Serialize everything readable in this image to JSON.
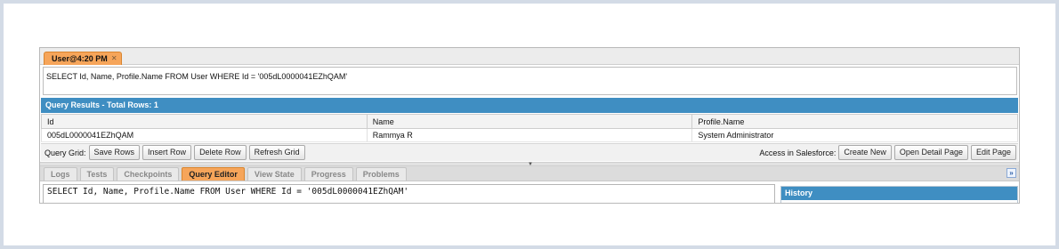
{
  "tab": {
    "label": "User@4:20 PM",
    "close_glyph": "✕"
  },
  "query": {
    "text": "SELECT Id, Name, Profile.Name FROM User WHERE Id = '005dL0000041EZhQAM'"
  },
  "results": {
    "title": "Query Results - Total Rows: 1",
    "columns": [
      "Id",
      "Name",
      "Profile.Name"
    ],
    "rows": [
      [
        "005dL0000041EZhQAM",
        "Rammya R",
        "System Administrator"
      ]
    ]
  },
  "grid_toolbar": {
    "label": "Query Grid:",
    "buttons": [
      "Save Rows",
      "Insert Row",
      "Delete Row",
      "Refresh Grid"
    ],
    "salesforce_label": "Access in Salesforce:",
    "salesforce_buttons": [
      "Create New",
      "Open Detail Page",
      "Edit Page"
    ]
  },
  "splitter": {
    "grip_glyph": "▼"
  },
  "bottom_tabs": {
    "items": [
      "Logs",
      "Tests",
      "Checkpoints",
      "Query Editor",
      "View State",
      "Progress",
      "Problems"
    ],
    "active": "Query Editor",
    "collapse_glyph": "»"
  },
  "editor": {
    "text": "SELECT Id, Name, Profile.Name FROM User WHERE Id = '005dL0000041EZhQAM'"
  },
  "history": {
    "title": "History"
  },
  "colors": {
    "accent_orange": "#f6a55a",
    "header_blue": "#3f8ec2"
  }
}
